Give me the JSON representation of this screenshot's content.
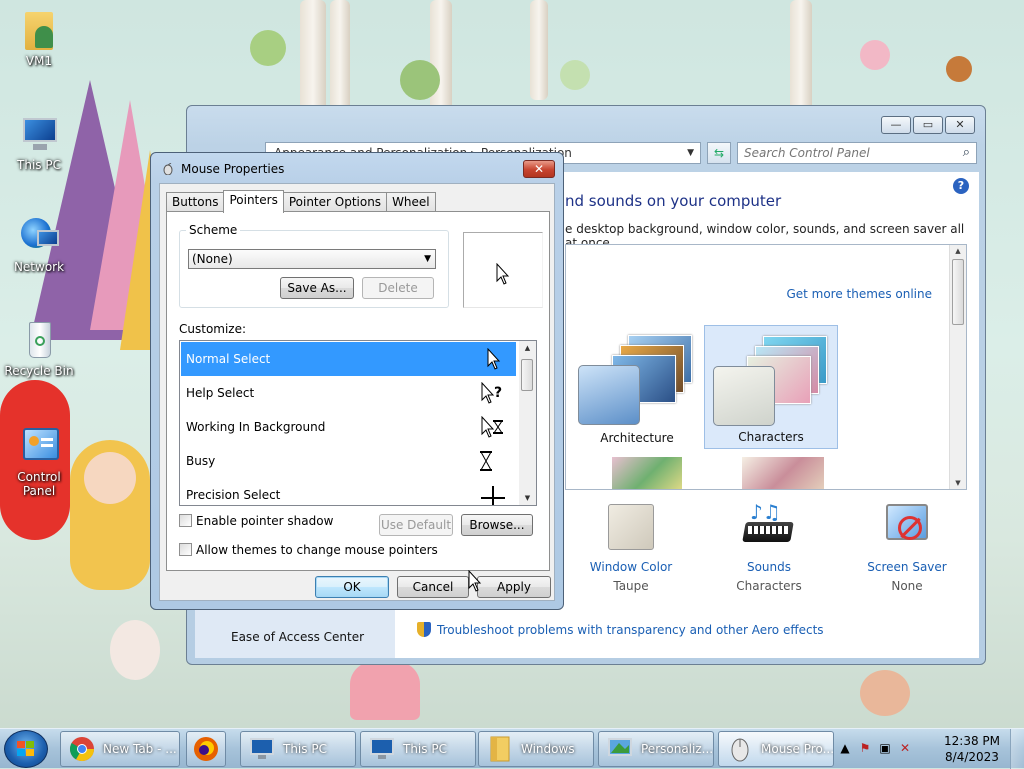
{
  "desktop": {
    "icons": [
      {
        "id": "vm1",
        "label": "VM1"
      },
      {
        "id": "this-pc",
        "label": "This PC"
      },
      {
        "id": "network",
        "label": "Network"
      },
      {
        "id": "recycle-bin",
        "label": "Recycle Bin"
      },
      {
        "id": "control-panel",
        "label": "Control Panel"
      }
    ]
  },
  "personalization": {
    "address_left": "Appearance and Personalization",
    "address_right": "Personalization",
    "search_placeholder": "Search Control Panel",
    "heading": "nd sounds on your computer",
    "subheading": "e desktop background, window color, sounds, and screen saver all at once.",
    "get_more_themes": "Get more themes online",
    "themes": [
      {
        "name": "Architecture",
        "selected": false
      },
      {
        "name": "Characters",
        "selected": true
      }
    ],
    "bottom_items": [
      {
        "title": "Window Color",
        "value": "Taupe",
        "icon": "window-color-icon"
      },
      {
        "title": "Sounds",
        "value": "Characters",
        "icon": "sounds-icon"
      },
      {
        "title": "Screen Saver",
        "value": "None",
        "icon": "screen-saver-icon"
      }
    ],
    "troubleshoot": "Troubleshoot problems with transparency and other Aero effects",
    "ease_of_access": "Ease of Access Center"
  },
  "mouse_dialog": {
    "title": "Mouse Properties",
    "close_glyph": "✕",
    "tabs": [
      "Buttons",
      "Pointers",
      "Pointer Options",
      "Wheel"
    ],
    "active_tab": "Pointers",
    "scheme_label": "Scheme",
    "scheme_value": "(None)",
    "save_as": "Save As...",
    "delete": "Delete",
    "customize_label": "Customize:",
    "pointer_rows": [
      {
        "label": "Normal Select",
        "selected": true,
        "cursor": "arrow"
      },
      {
        "label": "Help Select",
        "selected": false,
        "cursor": "help"
      },
      {
        "label": "Working In Background",
        "selected": false,
        "cursor": "working"
      },
      {
        "label": "Busy",
        "selected": false,
        "cursor": "busy"
      },
      {
        "label": "Precision Select",
        "selected": false,
        "cursor": "cross"
      }
    ],
    "enable_shadow": "Enable pointer shadow",
    "use_default": "Use Default",
    "browse": "Browse...",
    "allow_themes": "Allow themes to change mouse pointers",
    "ok": "OK",
    "cancel": "Cancel",
    "apply": "Apply"
  },
  "taskbar": {
    "items": [
      {
        "label": "New Tab - ...",
        "icon": "chrome-icon"
      },
      {
        "label": "",
        "icon": "firefox-icon"
      },
      {
        "label": "This PC",
        "icon": "computer-icon"
      },
      {
        "label": "This PC",
        "icon": "computer-icon"
      },
      {
        "label": "Windows",
        "icon": "folder-icon"
      },
      {
        "label": "Personaliz...",
        "icon": "personalization-icon"
      },
      {
        "label": "Mouse Pro...",
        "icon": "mouse-icon"
      }
    ],
    "time": "12:38 PM",
    "date": "8/4/2023"
  }
}
